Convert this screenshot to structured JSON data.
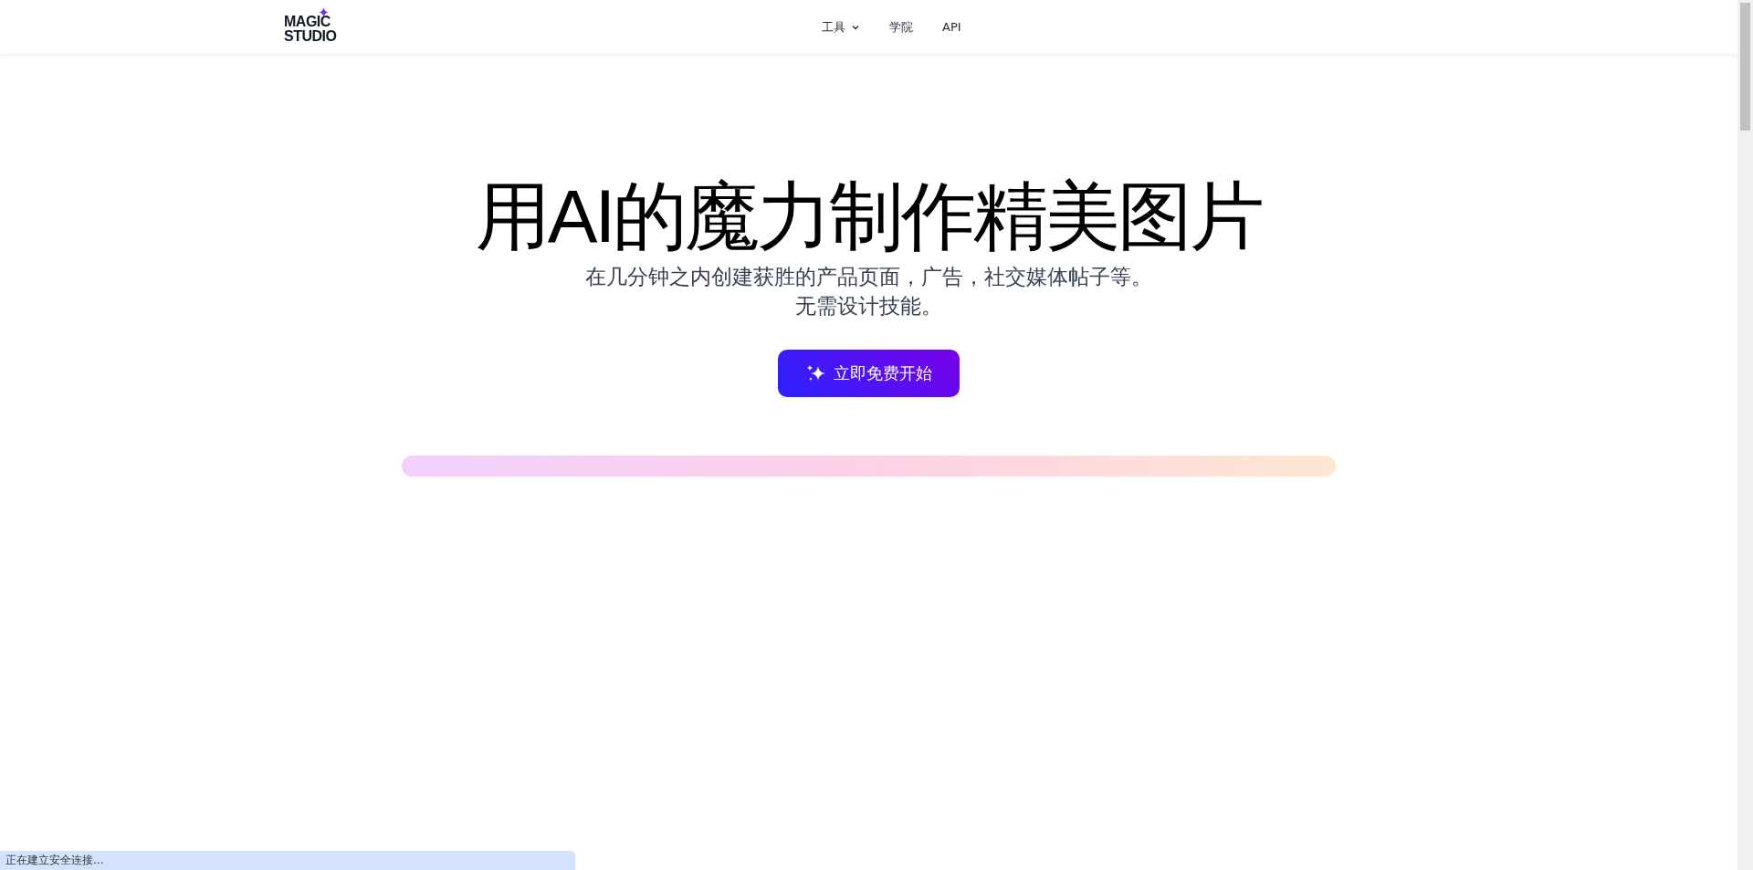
{
  "header": {
    "logo": {
      "line_1": "MAGIC",
      "line_2": "STUDIO"
    },
    "nav": [
      {
        "label": "工具",
        "kind": "dropdown"
      },
      {
        "label": "学院",
        "kind": "link"
      },
      {
        "label": "API",
        "kind": "link"
      }
    ]
  },
  "hero": {
    "title": "用AI的魔力制作精美图片",
    "subtitle_lines": [
      "在几分钟之内创建获胜的产品页面，广告，社交媒体帖子等。",
      "无需设计技能。"
    ],
    "cta": "立即免费开始"
  },
  "status_bar": {
    "text": "正在建立安全连接..."
  }
}
